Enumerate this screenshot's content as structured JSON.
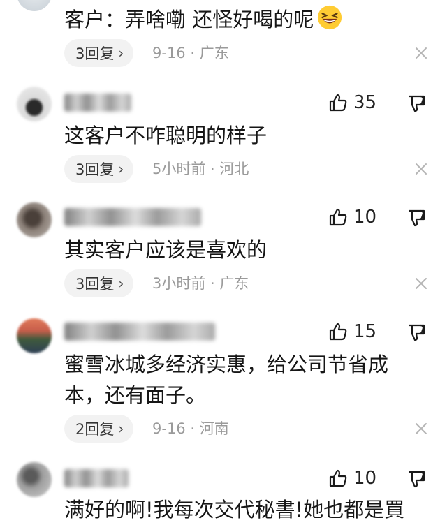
{
  "comments": [
    {
      "text": "客户：弄啥嘞 还怪好喝的呢",
      "emoji": "grinning-squint-emoji",
      "reply_label": "3回复",
      "date": "9-16",
      "location": "广东"
    },
    {
      "like_count": "35",
      "text": "这客户不咋聪明的样子",
      "reply_label": "3回复",
      "date": "5小时前",
      "location": "河北"
    },
    {
      "like_count": "10",
      "text": "其实客户应该是喜欢的",
      "reply_label": "3回复",
      "date": "3小时前",
      "location": "广东"
    },
    {
      "like_count": "15",
      "text_line1": "蜜雪冰城多经济实惠，给公司节省成",
      "text_line2": "本，还有面子。",
      "reply_label": "2回复",
      "date": "9-16",
      "location": "河南"
    },
    {
      "like_count": "10",
      "text": "满好的啊!我每次交代秘書!她也都是買"
    }
  ],
  "meta_separator": " · ",
  "colors": {
    "text": "#161616",
    "meta": "#9a9a9a",
    "pill_bg": "#f2f2f2"
  }
}
